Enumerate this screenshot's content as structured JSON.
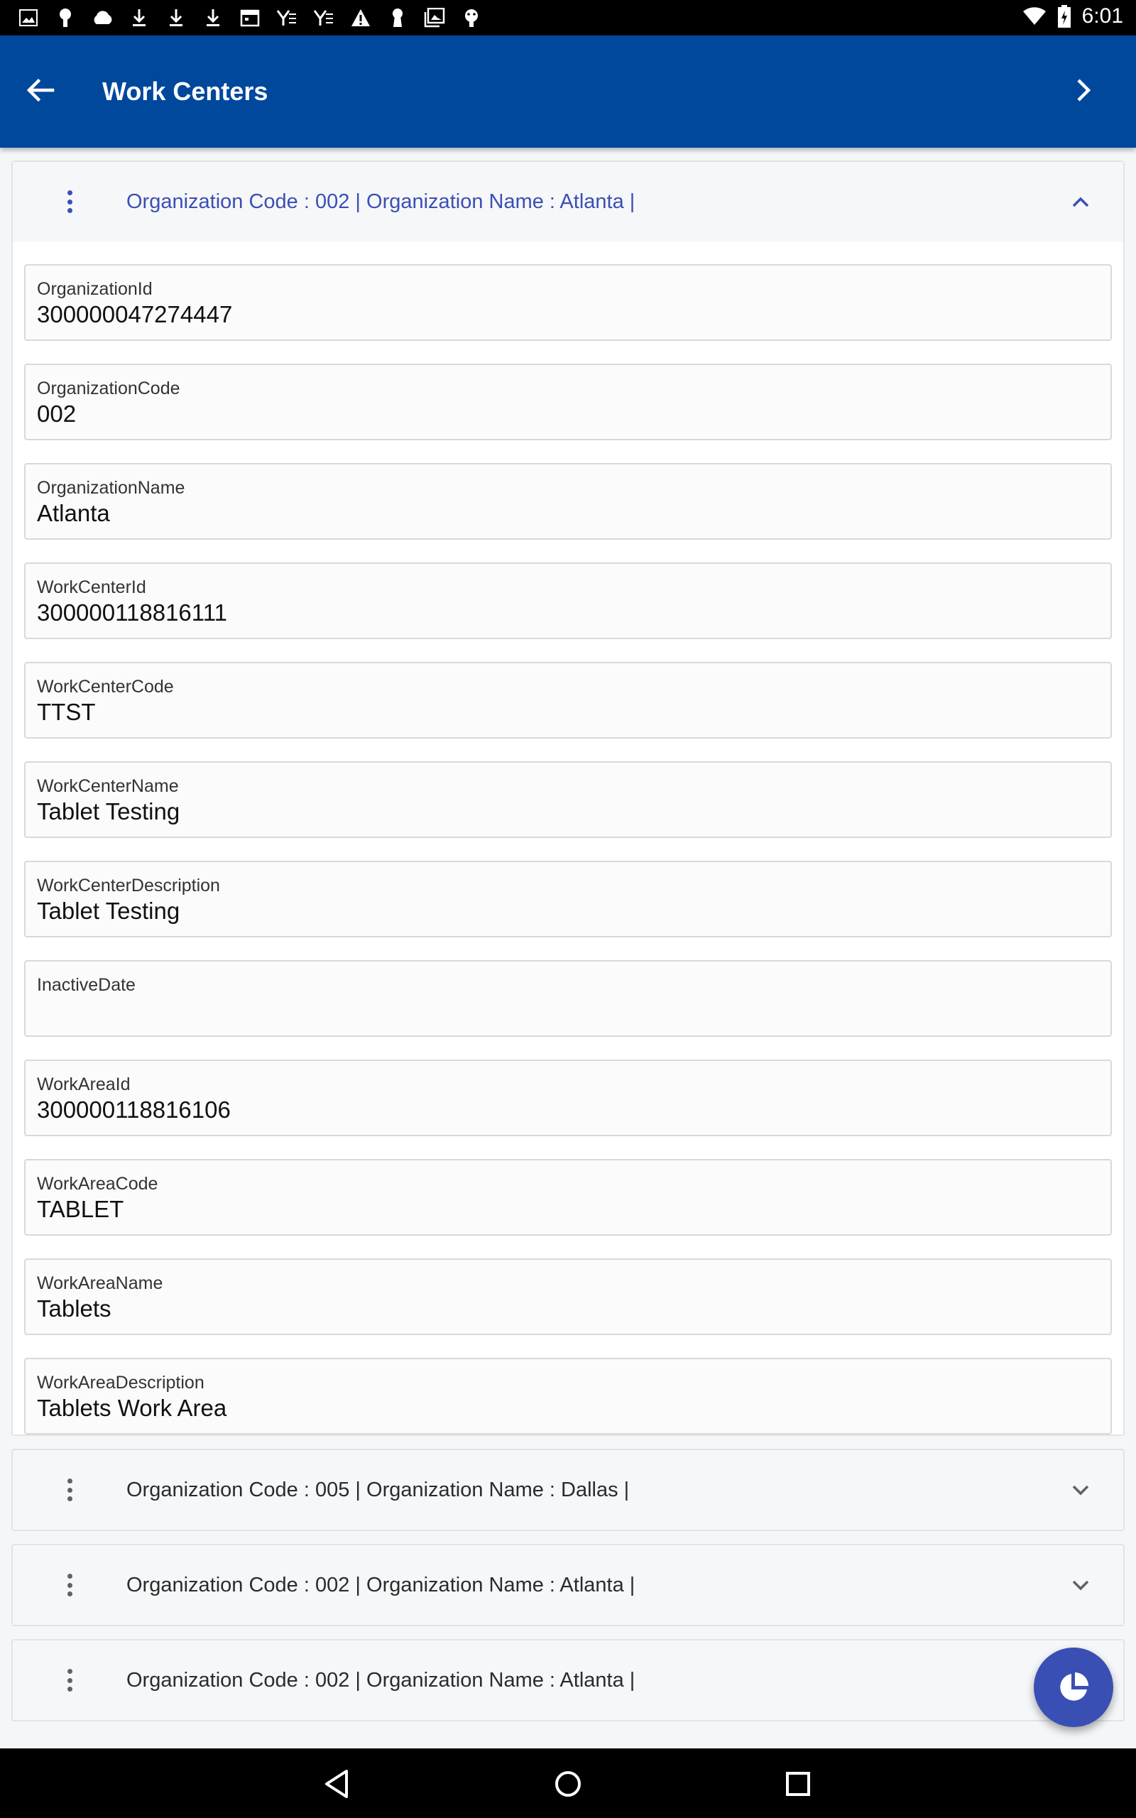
{
  "status_bar": {
    "time": "6:01",
    "left_icons": [
      "image-icon",
      "android-icon",
      "cloud-icon",
      "download-icon",
      "download-icon",
      "download-icon",
      "calendar-icon",
      "yammer-icon",
      "yammer-icon",
      "warning-icon",
      "keyhole-icon",
      "gallery-icon",
      "android-icon"
    ],
    "right_icons": [
      "wifi-icon",
      "battery-icon"
    ]
  },
  "app_bar": {
    "title": "Work Centers",
    "color": "#00489c"
  },
  "accent_color": "#3a4fb4",
  "expanded_card": {
    "header": "Organization Code : 002 | Organization Name : Atlanta |",
    "fields": [
      {
        "label": "OrganizationId",
        "value": "300000047274447"
      },
      {
        "label": "OrganizationCode",
        "value": "002"
      },
      {
        "label": "OrganizationName",
        "value": "Atlanta"
      },
      {
        "label": "WorkCenterId",
        "value": "300000118816111"
      },
      {
        "label": "WorkCenterCode",
        "value": "TTST"
      },
      {
        "label": "WorkCenterName",
        "value": "Tablet Testing"
      },
      {
        "label": "WorkCenterDescription",
        "value": "Tablet Testing"
      },
      {
        "label": "InactiveDate",
        "value": ""
      },
      {
        "label": "WorkAreaId",
        "value": "300000118816106"
      },
      {
        "label": "WorkAreaCode",
        "value": "TABLET"
      },
      {
        "label": "WorkAreaName",
        "value": "Tablets"
      },
      {
        "label": "WorkAreaDescription",
        "value": "Tablets Work Area"
      }
    ]
  },
  "collapsed_cards": [
    {
      "header": "Organization Code : 005 | Organization Name : Dallas |"
    },
    {
      "header": "Organization Code : 002 | Organization Name : Atlanta |"
    },
    {
      "header": "Organization Code : 002 | Organization Name : Atlanta |"
    }
  ]
}
